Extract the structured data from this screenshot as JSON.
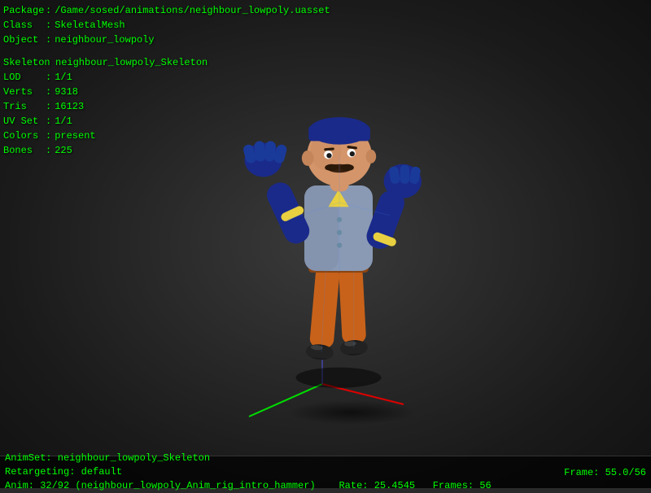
{
  "asset": {
    "package": "/Game/sosed/animations/neighbour_lowpoly.uasset",
    "class": "SkeletalMesh",
    "object": "neighbour_lowpoly"
  },
  "mesh_info": {
    "skeleton": "neighbour_lowpoly_Skeleton",
    "lod": "1/1",
    "verts": "9318",
    "tris": "16123",
    "uv_set": "1/1",
    "colors": "present",
    "bones": "225"
  },
  "labels": {
    "package": "Package",
    "class": "Class",
    "object": "Object",
    "skeleton": "Skeleton",
    "lod": "LOD",
    "verts": "Verts",
    "tris": "Tris",
    "uv_set": "UV Set",
    "colors": "Colors",
    "bones": "Bones"
  },
  "status": {
    "anim_set": "AnimSet: neighbour_lowpoly_Skeleton",
    "retargeting": "Retargeting: default",
    "anim": "Anim: 32/92 (neighbour_lowpoly_Anim_rig_intro_hammer)",
    "rate": "Rate: 25.4545",
    "frames": "Frames: 56",
    "frame": "Frame: 55.0/56"
  }
}
